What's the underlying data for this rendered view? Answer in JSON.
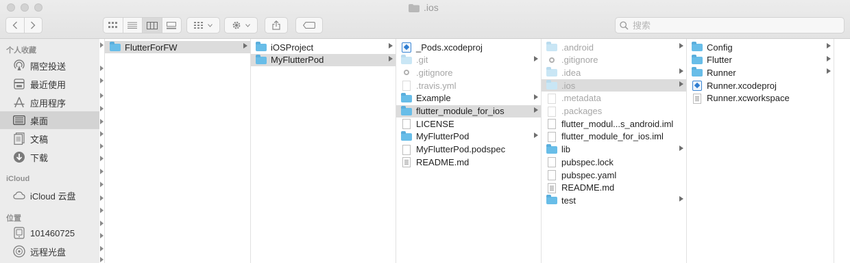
{
  "window": {
    "title": ".ios"
  },
  "search": {
    "placeholder": "搜索"
  },
  "sidebar": {
    "sections": [
      "个人收藏",
      "iCloud",
      "位置"
    ],
    "items": [
      {
        "label": "隔空投送",
        "icon": "airdrop-icon"
      },
      {
        "label": "最近使用",
        "icon": "recents-icon"
      },
      {
        "label": "应用程序",
        "icon": "applications-icon"
      },
      {
        "label": "桌面",
        "icon": "desktop-icon"
      },
      {
        "label": "文稿",
        "icon": "documents-icon"
      },
      {
        "label": "下载",
        "icon": "downloads-icon"
      },
      {
        "label": "iCloud 云盘",
        "icon": "icloud-icon"
      },
      {
        "label": "101460725",
        "icon": "disk-icon"
      },
      {
        "label": "远程光盘",
        "icon": "optical-disc-icon"
      }
    ]
  },
  "columns": [
    [
      {
        "label": "FlutterForFW",
        "type": "folder",
        "arrow": true,
        "selected": true
      }
    ],
    [
      {
        "label": "iOSProject",
        "type": "folder",
        "arrow": true
      },
      {
        "label": "MyFlutterPod",
        "type": "folder",
        "arrow": true,
        "selected": true
      }
    ],
    [
      {
        "label": "_Pods.xcodeproj",
        "type": "xcode"
      },
      {
        "label": ".git",
        "type": "folder",
        "dim": true,
        "arrow": true
      },
      {
        "label": ".gitignore",
        "type": "gear",
        "dim": true
      },
      {
        "label": ".travis.yml",
        "type": "doc",
        "dim": true
      },
      {
        "label": "Example",
        "type": "folder",
        "arrow": true
      },
      {
        "label": "flutter_module_for_ios",
        "type": "folder",
        "arrow": true,
        "selected": true
      },
      {
        "label": "LICENSE",
        "type": "doc"
      },
      {
        "label": "MyFlutterPod",
        "type": "folder",
        "arrow": true
      },
      {
        "label": "MyFlutterPod.podspec",
        "type": "doc"
      },
      {
        "label": "README.md",
        "type": "doclines"
      }
    ],
    [
      {
        "label": ".android",
        "type": "folder",
        "dim": true,
        "arrow": true
      },
      {
        "label": ".gitignore",
        "type": "gear",
        "dim": true
      },
      {
        "label": ".idea",
        "type": "folder",
        "dim": true,
        "arrow": true
      },
      {
        "label": ".ios",
        "type": "folder",
        "dim": true,
        "arrow": true,
        "selected": true
      },
      {
        "label": ".metadata",
        "type": "doc",
        "dim": true
      },
      {
        "label": ".packages",
        "type": "doc",
        "dim": true
      },
      {
        "label": "flutter_modul...s_android.iml",
        "type": "doc"
      },
      {
        "label": "flutter_module_for_ios.iml",
        "type": "doc"
      },
      {
        "label": "lib",
        "type": "folder",
        "arrow": true
      },
      {
        "label": "pubspec.lock",
        "type": "doc"
      },
      {
        "label": "pubspec.yaml",
        "type": "doc"
      },
      {
        "label": "README.md",
        "type": "doclines"
      },
      {
        "label": "test",
        "type": "folder",
        "arrow": true
      }
    ],
    [
      {
        "label": "Config",
        "type": "folder",
        "arrow": true
      },
      {
        "label": "Flutter",
        "type": "folder",
        "arrow": true
      },
      {
        "label": "Runner",
        "type": "folder",
        "arrow": true
      },
      {
        "label": "Runner.xcodeproj",
        "type": "xcode"
      },
      {
        "label": "Runner.xcworkspace",
        "type": "doclines"
      }
    ]
  ]
}
